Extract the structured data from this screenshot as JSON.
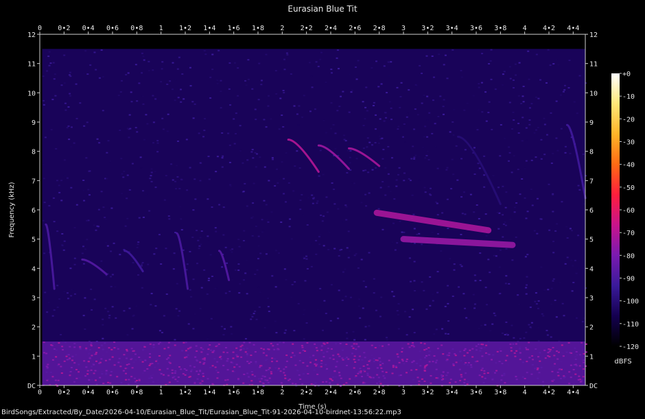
{
  "chart_data": {
    "type": "heatmap",
    "title": "Eurasian Blue Tit",
    "xlabel": "Time (s)",
    "ylabel": "Frequency (kHz)",
    "xlim": [
      0,
      4.5
    ],
    "ylim": [
      0,
      12
    ],
    "x_ticks": [
      "0",
      "0•2",
      "0•4",
      "0•6",
      "0•8",
      "1",
      "1•2",
      "1•4",
      "1•6",
      "1•8",
      "2",
      "2•2",
      "2•4",
      "2•6",
      "2•8",
      "3",
      "3•2",
      "3•4",
      "3•6",
      "3•8",
      "4",
      "4•2",
      "4•4"
    ],
    "x_tick_values": [
      0,
      0.2,
      0.4,
      0.6,
      0.8,
      1,
      1.2,
      1.4,
      1.6,
      1.8,
      2,
      2.2,
      2.4,
      2.6,
      2.8,
      3,
      3.2,
      3.4,
      3.6,
      3.8,
      4,
      4.2,
      4.4
    ],
    "y_ticks": [
      "DC",
      "1",
      "2",
      "3",
      "4",
      "5",
      "6",
      "7",
      "8",
      "9",
      "10",
      "11",
      "12"
    ],
    "y_tick_values": [
      0,
      1,
      2,
      3,
      4,
      5,
      6,
      7,
      8,
      9,
      10,
      11,
      12
    ],
    "colorbar": {
      "label": "dBFS",
      "range": [
        -120,
        0
      ],
      "ticks": [
        "+0",
        "-10",
        "-20",
        "-30",
        "-40",
        "-50",
        "-60",
        "-70",
        "-80",
        "-90",
        "-100",
        "-110",
        "-120"
      ],
      "tick_values": [
        0,
        -10,
        -20,
        -30,
        -40,
        -50,
        -60,
        -70,
        -80,
        -90,
        -100,
        -110,
        -120
      ],
      "colors": [
        "#000000",
        "#140050",
        "#3a1a9a",
        "#7a1ab0",
        "#c8148c",
        "#ff1e3c",
        "#ff6a14",
        "#ffb428",
        "#ffe878",
        "#ffffff"
      ]
    },
    "signal_content": {
      "data_time_range_s": [
        0.02,
        4.5
      ],
      "data_freq_range_khz": [
        0,
        11.5
      ],
      "background_level_dbfs": -105,
      "low_frequency_noise": {
        "freq_khz": [
          0,
          1.5
        ],
        "level_dbfs": -85
      },
      "call_events": [
        {
          "name": "descending whistle",
          "t_start": 0.05,
          "t_end": 0.12,
          "f_start": 5.5,
          "f_end": 3.3,
          "level_dbfs": -90
        },
        {
          "name": "note",
          "t_start": 0.35,
          "t_end": 0.55,
          "f_start": 4.3,
          "f_end": 3.8,
          "level_dbfs": -88
        },
        {
          "name": "note",
          "t_start": 0.7,
          "t_end": 0.85,
          "f_start": 4.6,
          "f_end": 3.9,
          "level_dbfs": -92
        },
        {
          "name": "descending whistle",
          "t_start": 1.13,
          "t_end": 1.22,
          "f_start": 5.2,
          "f_end": 3.3,
          "level_dbfs": -90
        },
        {
          "name": "descending whistle",
          "t_start": 1.48,
          "t_end": 1.56,
          "f_start": 4.6,
          "f_end": 3.6,
          "level_dbfs": -88
        },
        {
          "name": "trill arc",
          "t_start": 2.05,
          "t_end": 2.3,
          "f_start": 8.4,
          "f_end": 7.3,
          "level_dbfs": -70
        },
        {
          "name": "trill arc",
          "t_start": 2.3,
          "t_end": 2.55,
          "f_start": 8.2,
          "f_end": 7.4,
          "level_dbfs": -74
        },
        {
          "name": "trill arc",
          "t_start": 2.55,
          "t_end": 2.8,
          "f_start": 8.1,
          "f_end": 7.5,
          "level_dbfs": -72
        },
        {
          "name": "trill band",
          "t_start": 2.78,
          "t_end": 3.7,
          "f_start": 5.9,
          "f_end": 5.3,
          "level_dbfs": -72
        },
        {
          "name": "trill band",
          "t_start": 3.0,
          "t_end": 3.9,
          "f_start": 5.0,
          "f_end": 4.8,
          "level_dbfs": -75
        },
        {
          "name": "faint sweep",
          "t_start": 3.45,
          "t_end": 3.8,
          "f_start": 8.5,
          "f_end": 6.2,
          "level_dbfs": -100
        },
        {
          "name": "faint sweep",
          "t_start": 4.35,
          "t_end": 4.5,
          "f_start": 8.9,
          "f_end": 6.4,
          "level_dbfs": -92
        }
      ]
    }
  },
  "footer": {
    "filename": "BirdSongs/Extracted/By_Date/2026-04-10/Eurasian_Blue_Tit/Eurasian_Blue_Tit-91-2026-04-10-birdnet-13:56:22.mp3"
  }
}
